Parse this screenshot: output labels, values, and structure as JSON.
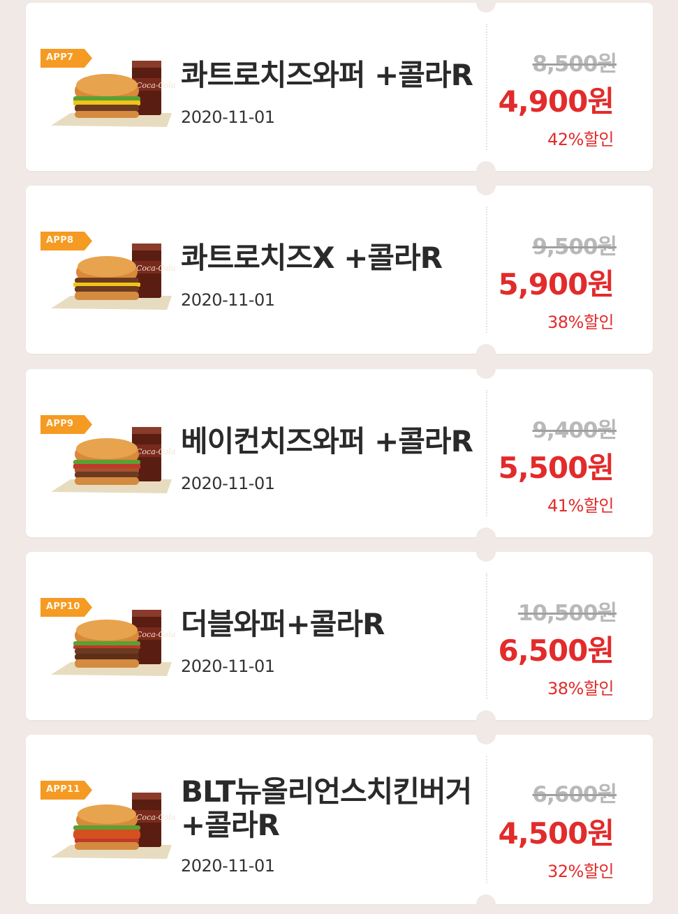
{
  "coupons": [
    {
      "badge": "APP7",
      "title": "콰트로치즈와퍼 +콜라R",
      "date": "2020-11-01",
      "original_price": "8,500원",
      "sale_price": "4,900원",
      "discount": "42%할인"
    },
    {
      "badge": "APP8",
      "title": "콰트로치즈X +콜라R",
      "date": "2020-11-01",
      "original_price": "9,500원",
      "sale_price": "5,900원",
      "discount": "38%할인"
    },
    {
      "badge": "APP9",
      "title": "베이컨치즈와퍼 +콜라R",
      "date": "2020-11-01",
      "original_price": "9,400원",
      "sale_price": "5,500원",
      "discount": "41%할인"
    },
    {
      "badge": "APP10",
      "title": "더블와퍼+콜라R",
      "date": "2020-11-01",
      "original_price": "10,500원",
      "sale_price": "6,500원",
      "discount": "38%할인"
    },
    {
      "badge": "APP11",
      "title": "BLT뉴올리언스치킨버거 +콜라R",
      "date": "2020-11-01",
      "original_price": "6,600원",
      "sale_price": "4,500원",
      "discount": "32%할인"
    }
  ],
  "icons": {
    "product_image": "burger-and-cola-icon"
  }
}
